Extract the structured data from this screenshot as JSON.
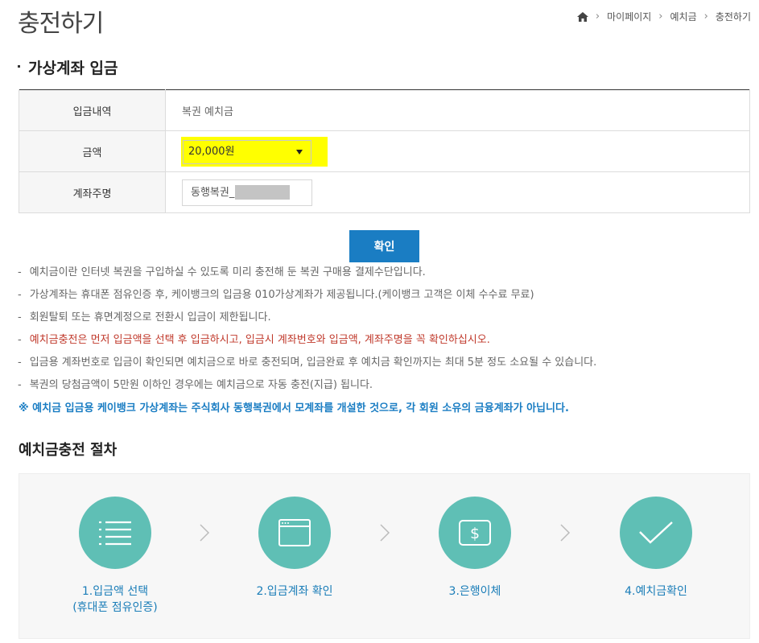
{
  "header": {
    "title": "충전하기",
    "breadcrumb": [
      "마이페이지",
      "예치금",
      "충전하기"
    ]
  },
  "section": {
    "title": "가상계좌 입금"
  },
  "form": {
    "rows": [
      {
        "label": "입금내역",
        "value": "복권 예치금"
      },
      {
        "label": "금액",
        "value": "20,000원"
      },
      {
        "label": "계좌주명",
        "value": "동행복권_"
      }
    ]
  },
  "confirm_label": "확인",
  "notes": {
    "dash": "-",
    "items": [
      "예치금이란 인터넷 복권을 구입하실 수 있도록 미리 충전해 둔 복권 구매용 결제수단입니다.",
      "가상계좌는 휴대폰 점유인증 후, 케이뱅크의 입금용 010가상계좌가 제공됩니다.(케이뱅크 고객은 이체 수수료 무료)",
      "회원탈퇴 또는 휴면계정으로 전환시 입금이 제한됩니다.",
      "예치금충전은 먼저 입금액을 선택 후 입금하시고, 입금시 계좌번호와 입금액, 계좌주명을 꼭 확인하십시오.",
      "입금용 계좌번호로 입금이 확인되면 예치금으로 바로 충전되며, 입금완료 후 예치금 확인까지는 최대 5분 정도 소요될 수 있습니다.",
      "복권의 당첨금액이 5만원 이하인 경우에는 예치금으로 자동 충전(지급) 됩니다."
    ],
    "blue": "※ 예치금 입금용 케이뱅크 가상계좌는 주식회사 동행복권에서 모계좌를 개설한 것으로, 각 회원 소유의 금융계좌가 아닙니다."
  },
  "procedure": {
    "title": "예치금충전 절차",
    "steps": [
      {
        "label": "1.입금액 선택",
        "sub": "(휴대폰 점유인증)",
        "icon": "list-icon"
      },
      {
        "label": "2.입금계좌 확인",
        "sub": "",
        "icon": "browser-window-icon"
      },
      {
        "label": "3.은행이체",
        "sub": "",
        "icon": "dollar-icon"
      },
      {
        "label": "4.예치금확인",
        "sub": "",
        "icon": "checkmark-icon"
      }
    ]
  },
  "colors": {
    "accent": "#1a7dc3",
    "teal": "#5fbfb5",
    "highlight": "#ffff00",
    "warning": "#c0392b"
  }
}
